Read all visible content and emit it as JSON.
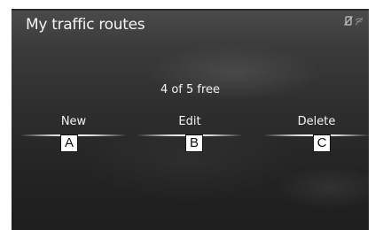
{
  "screen": {
    "title": "My traffic routes",
    "status_icons": [
      "no-phone-icon",
      "signal-icon"
    ],
    "free_count": "4 of 5 free"
  },
  "buttons": {
    "new": "New",
    "edit": "Edit",
    "delete": "Delete"
  },
  "callouts": {
    "a": "A",
    "b": "B",
    "c": "C"
  },
  "colors": {
    "text": "#f4f4f4",
    "underline": "#ffffff"
  }
}
